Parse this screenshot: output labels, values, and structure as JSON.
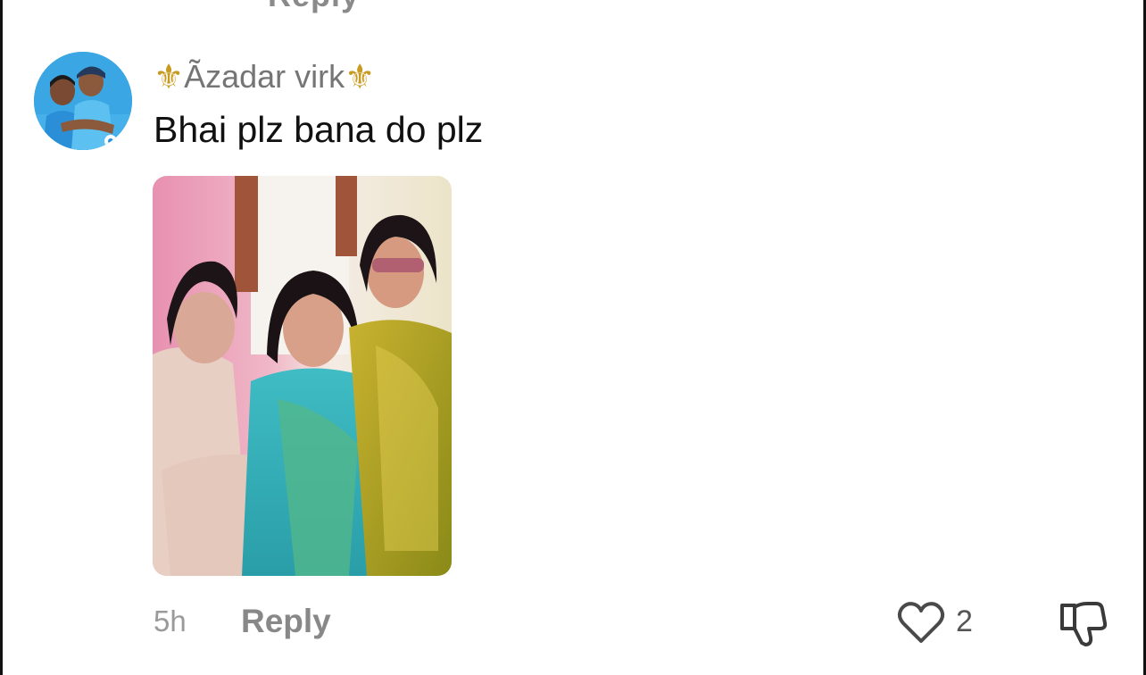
{
  "previous_comment": {
    "cut_reply_label": "Reply"
  },
  "comment": {
    "username": "Ãzadar virk",
    "username_prefix_icon": "fleur-de-lis-icon",
    "username_suffix_icon": "fleur-de-lis-icon",
    "text": "Bhai plz bana do plz",
    "timestamp": "5h",
    "reply_label": "Reply",
    "like_count": "2",
    "like_icon": "heart-outline-icon",
    "dislike_icon": "thumbs-down-icon"
  },
  "colors": {
    "background": "#ffffff",
    "username": "#757575",
    "fleur": "#c99a20",
    "text": "#111111",
    "muted": "#9a9a9a"
  }
}
